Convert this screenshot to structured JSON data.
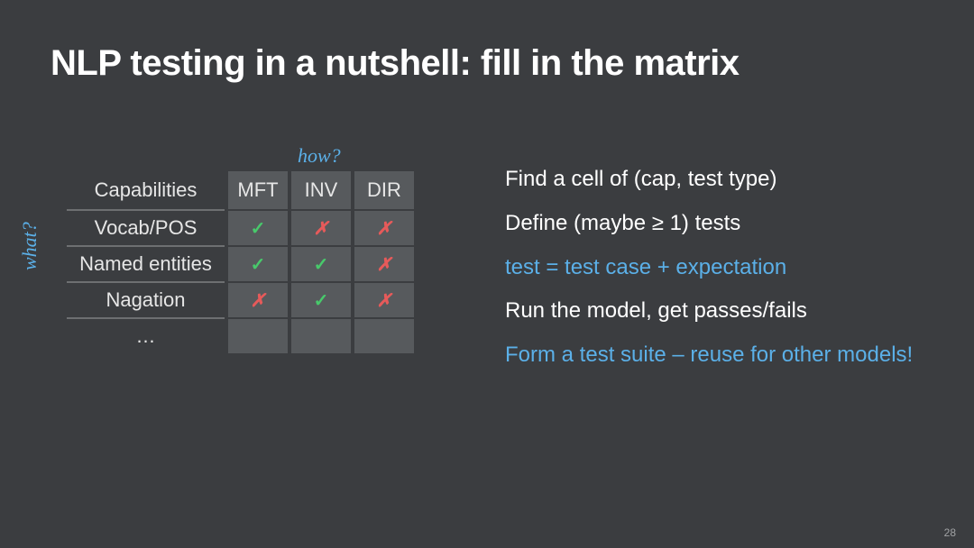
{
  "title": "NLP testing in a nutshell: fill in the matrix",
  "labels": {
    "how": "how?",
    "what": "what?"
  },
  "matrix": {
    "caps_header": "Capabilities",
    "cols": [
      "MFT",
      "INV",
      "DIR"
    ],
    "rows": [
      {
        "label": "Vocab/POS",
        "cells": [
          "pass",
          "fail",
          "fail"
        ]
      },
      {
        "label": "Named entities",
        "cells": [
          "pass",
          "pass",
          "fail"
        ]
      },
      {
        "label": "Nagation",
        "cells": [
          "fail",
          "pass",
          "fail"
        ]
      },
      {
        "label": "…",
        "cells": [
          "",
          "",
          ""
        ]
      }
    ]
  },
  "steps": [
    {
      "text": "Find a cell of (cap, test type)",
      "accent": false
    },
    {
      "text": "Define (maybe ≥ 1) tests",
      "accent": false
    },
    {
      "text": "test = test case + expectation",
      "accent": true
    },
    {
      "text": "Run the model, get passes/fails",
      "accent": false
    },
    {
      "text": "Form a test suite – reuse for other models!",
      "accent": true
    }
  ],
  "page_number": "28"
}
